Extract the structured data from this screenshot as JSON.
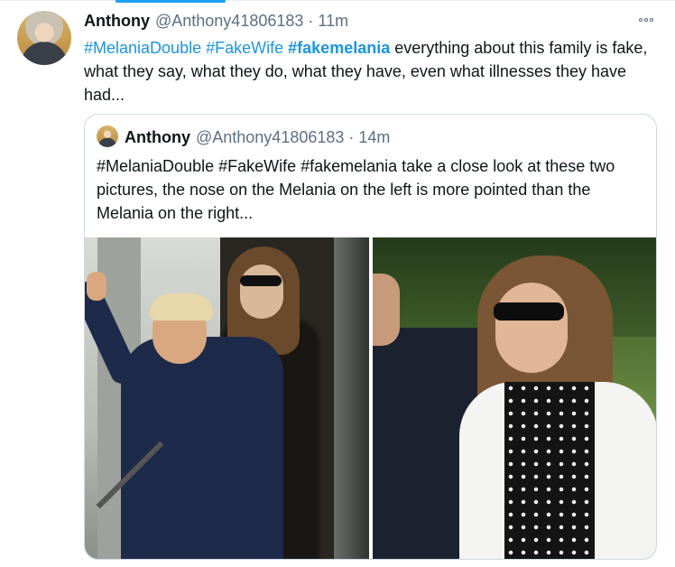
{
  "tweet": {
    "name": "Anthony",
    "handle": "@Anthony41806183",
    "separator": "·",
    "time": "11m",
    "hashtags": [
      "#MelaniaDouble",
      "#FakeWife",
      "#fakemelania"
    ],
    "text": "everything about this family is fake, what they say, what they do, what they have, even what illnesses they have had..."
  },
  "quoted": {
    "name": "Anthony",
    "handle": "@Anthony41806183",
    "separator": "·",
    "time": "14m",
    "text": "#MelaniaDouble #FakeWife #fakemelania take a close look at these two pictures, the nose on the Melania on the left is more pointed than the Melania on the right..."
  },
  "icons": {
    "more": "more-horizontal-icon"
  },
  "colors": {
    "link": "#1b95e0",
    "secondary_text": "#5b7083",
    "accent": "#1da1f2",
    "border": "#cfd9de"
  }
}
